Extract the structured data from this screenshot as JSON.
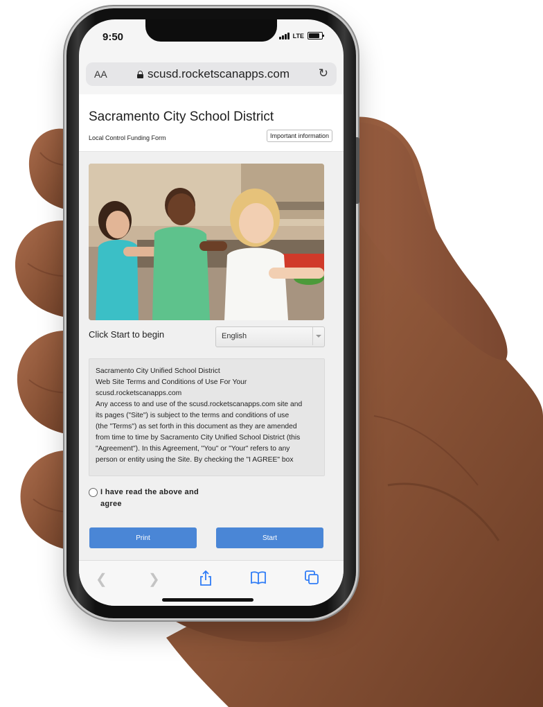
{
  "status_bar": {
    "time": "9:50",
    "network": "LTE"
  },
  "browser": {
    "text_size_label": "AA",
    "url": "scusd.rocketscanapps.com"
  },
  "site": {
    "title": "Sacramento City School District",
    "subtitle": "Local Control Funding Form",
    "info_button": "Important information"
  },
  "form": {
    "start_prompt": "Click Start to begin",
    "language_selected": "English",
    "terms_lines": [
      "Sacramento City Unified School District",
      "Web Site Terms and Conditions of Use For Your",
      "scusd.rocketscanapps.com",
      "Any access to and use of the scusd.rocketscanapps.com site and",
      "its pages (\"Site\") is subject to the terms and conditions of use",
      "(the \"Terms\") as set forth in this document as they are amended",
      "from time to time by Sacramento City Unified School District (this",
      "\"Agreement\"). In this Agreement, \"You\" or \"Your\" refers to any",
      "person or entity using the Site. By checking the \"I AGREE\" box"
    ],
    "agree_line1": "I have read the above and",
    "agree_line2": "agree",
    "print_label": "Print",
    "start_label": "Start"
  },
  "colors": {
    "button": "#4a86d6",
    "ios_blue": "#2f7cf6"
  },
  "toolbar_icons": [
    "back-icon",
    "forward-icon",
    "share-icon",
    "bookmarks-icon",
    "tabs-icon"
  ]
}
